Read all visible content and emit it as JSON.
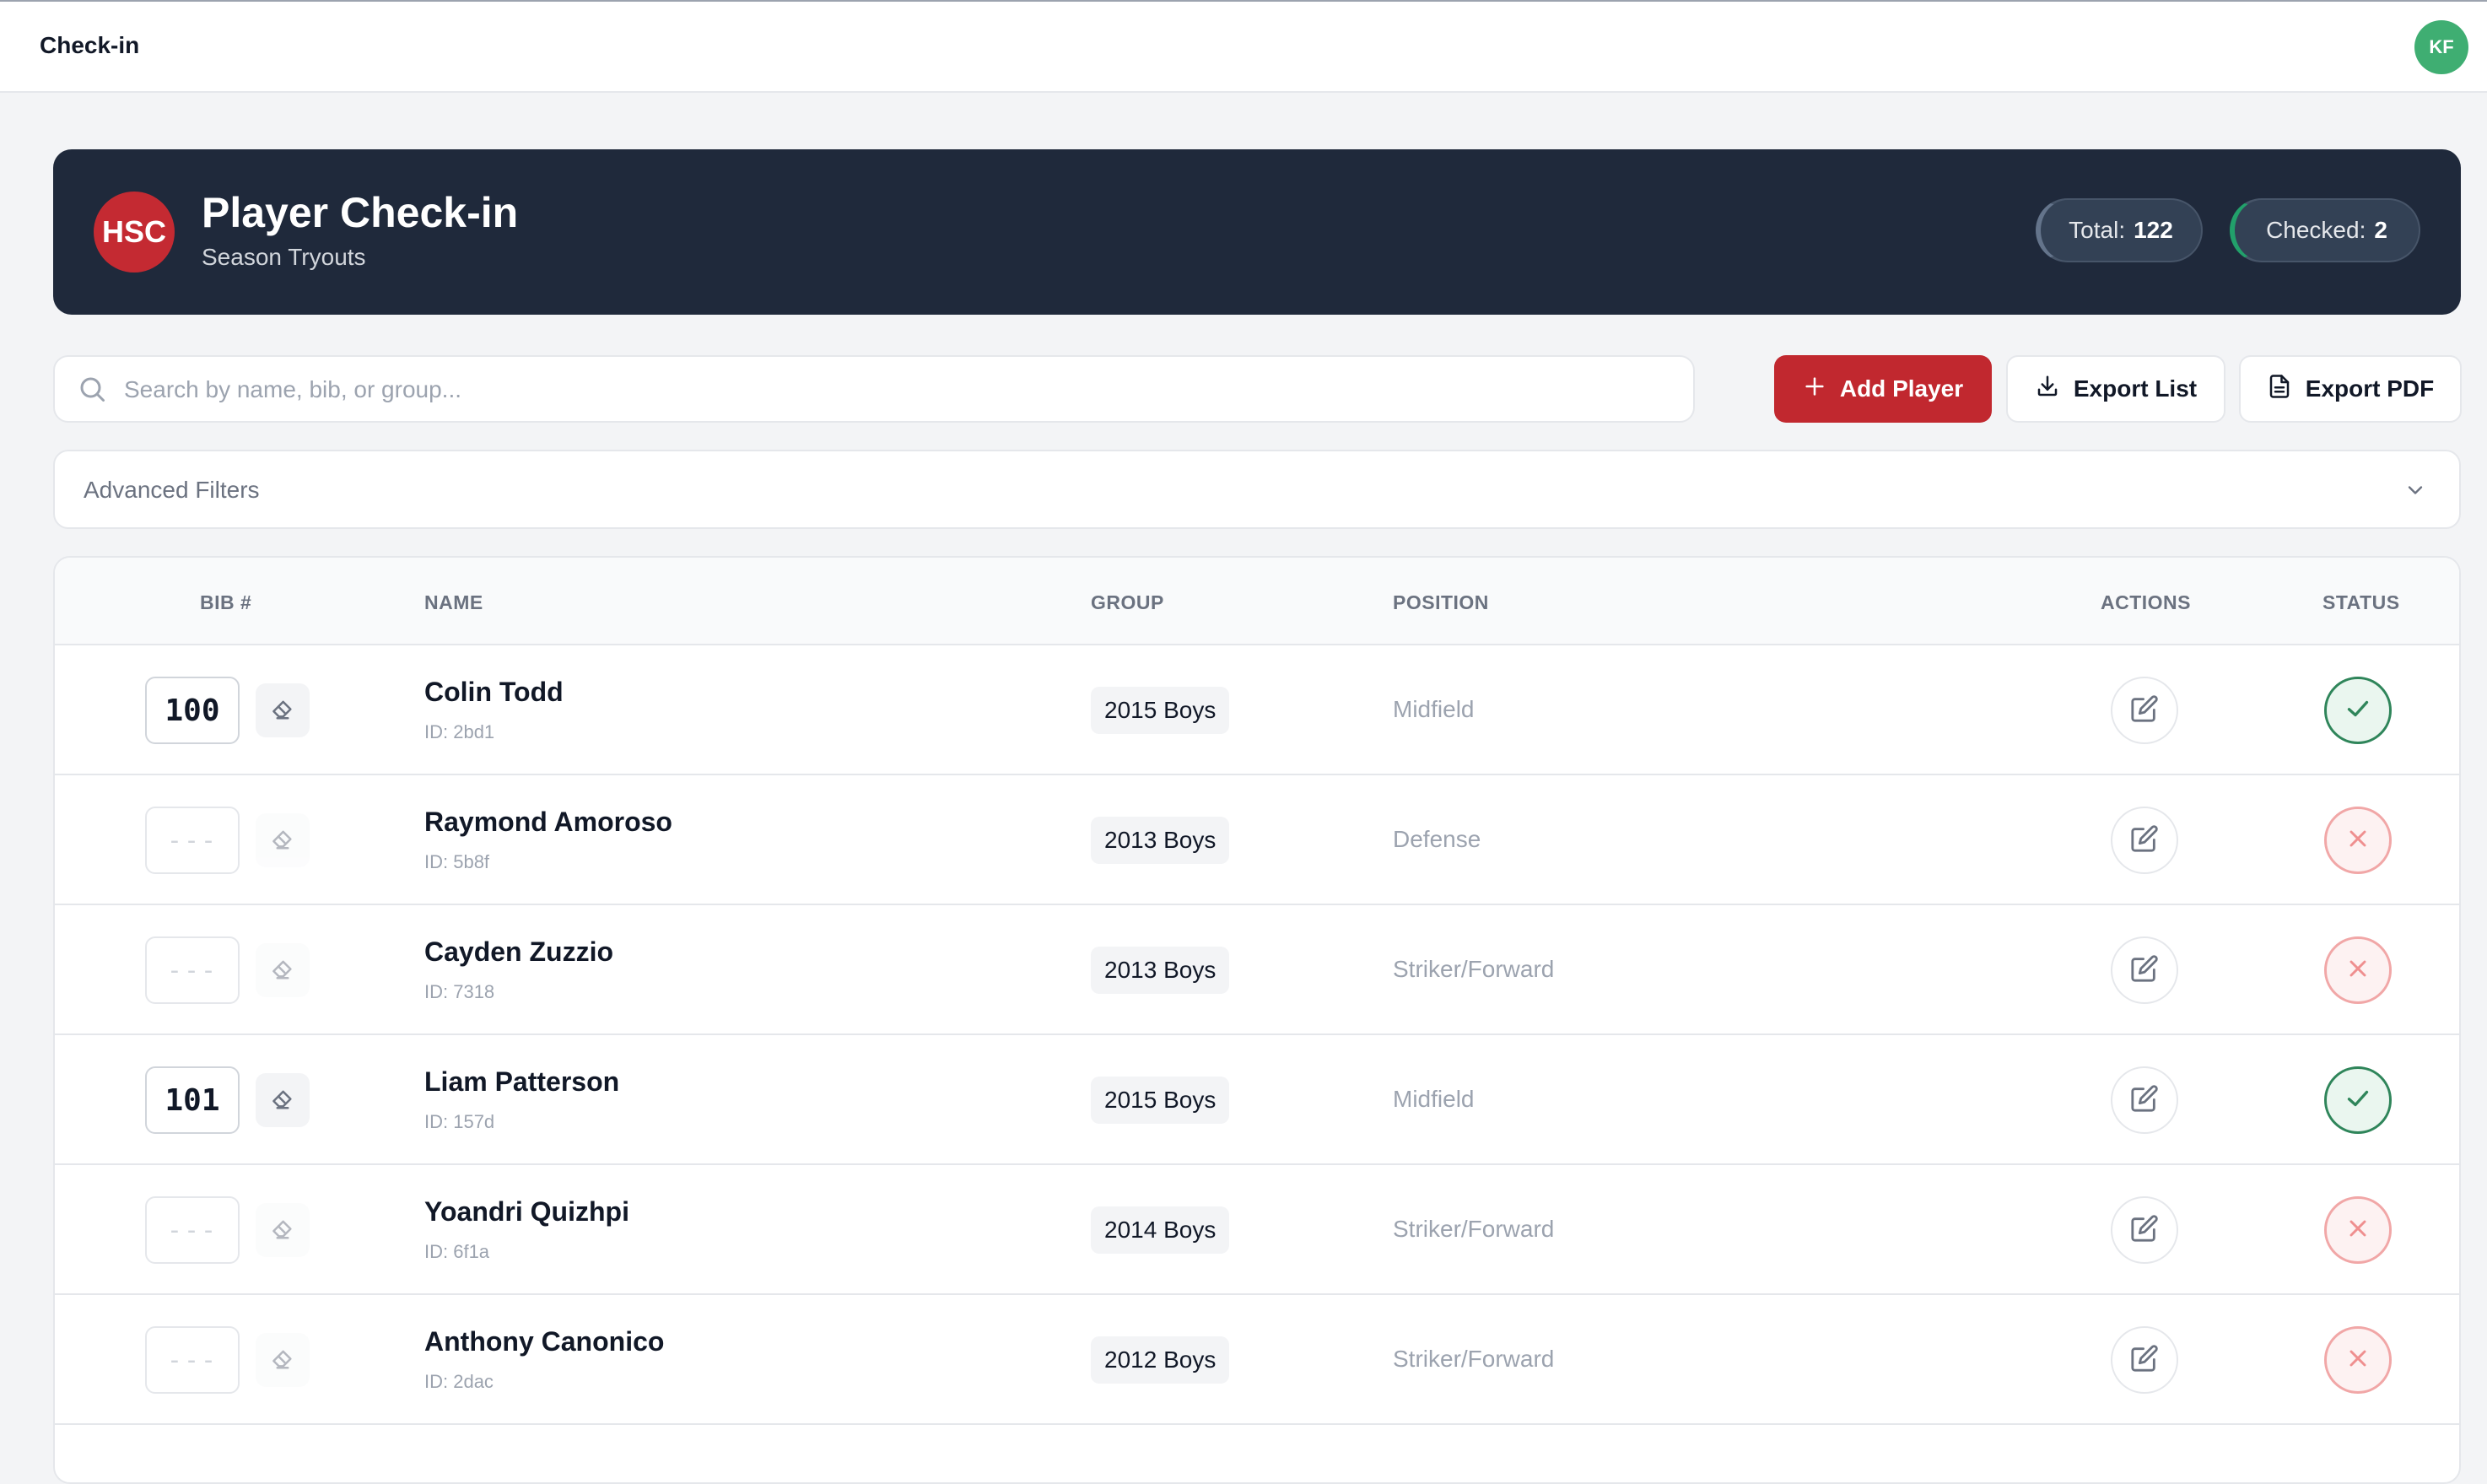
{
  "app": {
    "title": "Check-in",
    "user_initials": "KF"
  },
  "header": {
    "logo_text": "HSC",
    "title": "Player Check-in",
    "subtitle": "Season Tryouts",
    "total_label": "Total:",
    "total_value": "122",
    "checked_label": "Checked:",
    "checked_value": "2"
  },
  "search": {
    "placeholder": "Search by name, bib, or group..."
  },
  "toolbar": {
    "add_label": "Add Player",
    "export_list_label": "Export List",
    "export_pdf_label": "Export PDF"
  },
  "filters": {
    "label": "Advanced Filters"
  },
  "table": {
    "columns": {
      "bib": "BIB #",
      "name": "NAME",
      "group": "GROUP",
      "position": "POSITION",
      "actions": "ACTIONS",
      "status": "STATUS"
    },
    "empty_bib": "---",
    "rows": [
      {
        "bib": "100",
        "name": "Colin Todd",
        "id": "ID: 2bd1",
        "group": "2015 Boys",
        "position": "Midfield",
        "checked": true
      },
      {
        "bib": "",
        "name": "Raymond Amoroso",
        "id": "ID: 5b8f",
        "group": "2013 Boys",
        "position": "Defense",
        "checked": false
      },
      {
        "bib": "",
        "name": "Cayden Zuzzio",
        "id": "ID: 7318",
        "group": "2013 Boys",
        "position": "Striker/Forward",
        "checked": false
      },
      {
        "bib": "101",
        "name": "Liam Patterson",
        "id": "ID: 157d",
        "group": "2015 Boys",
        "position": "Midfield",
        "checked": true
      },
      {
        "bib": "",
        "name": "Yoandri Quizhpi",
        "id": "ID: 6f1a",
        "group": "2014 Boys",
        "position": "Striker/Forward",
        "checked": false
      },
      {
        "bib": "",
        "name": "Anthony Canonico",
        "id": "ID: 2dac",
        "group": "2012 Boys",
        "position": "Striker/Forward",
        "checked": false
      }
    ]
  },
  "colors": {
    "accent": "#c1282f",
    "header_bg": "#1f293b",
    "checked": "#2f855a",
    "unchecked": "#f1a7a7"
  },
  "icons": {
    "search": "search-icon",
    "add": "plus-icon",
    "export_list": "download-icon",
    "export_pdf": "document-icon",
    "filters": "chevron-down-icon",
    "clear_bib": "eraser-icon",
    "edit": "edit-icon",
    "checked": "check-icon",
    "unchecked": "x-icon"
  }
}
